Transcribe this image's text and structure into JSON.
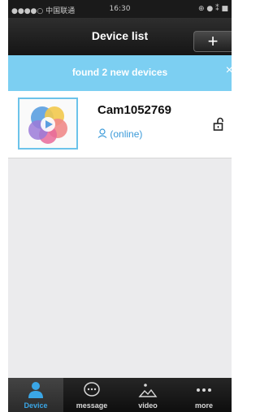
{
  "status_bar": {
    "carrier": "●●●●○ 中国联通",
    "time": "16:30",
    "system": "⊕ ● ⁑ ■"
  },
  "nav": {
    "title": "Device list",
    "add_label": "+"
  },
  "banner": {
    "message": "found 2 new devices",
    "close_label": "×"
  },
  "devices": [
    {
      "name": "Cam1052769",
      "status": "(online)"
    }
  ],
  "tabs": [
    {
      "label": "Device",
      "icon": "person-icon",
      "active": true
    },
    {
      "label": "message",
      "icon": "chat-bubble-icon",
      "active": false
    },
    {
      "label": "video",
      "icon": "image-icon",
      "active": false
    },
    {
      "label": "more",
      "icon": "more-dots-icon",
      "active": false
    }
  ],
  "colors": {
    "accent": "#3aa6e6",
    "banner": "#7ccff2",
    "nav_bar": "#1f1f1f"
  }
}
